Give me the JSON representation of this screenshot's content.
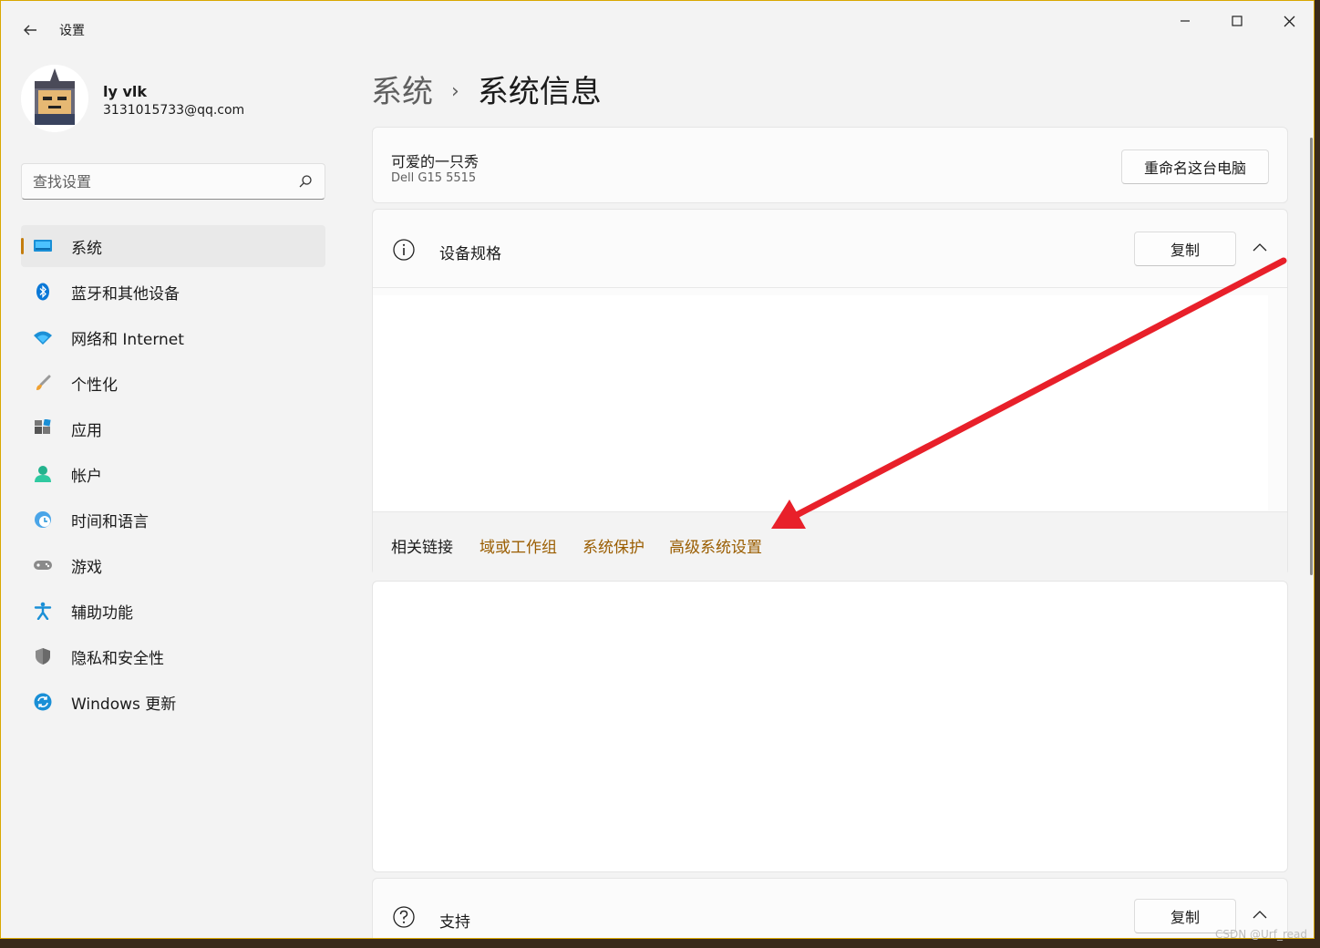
{
  "window": {
    "title": "设置",
    "back_icon": "back-arrow-icon",
    "controls": {
      "minimize": "—",
      "maximize": "☐",
      "close": "✕"
    }
  },
  "profile": {
    "name": "ly vlk",
    "email": "3131015733@qq.com"
  },
  "search": {
    "placeholder": "查找设置",
    "icon": "search-icon"
  },
  "sidebar": {
    "items": [
      {
        "label": "系统",
        "icon": "monitor-icon",
        "active": true
      },
      {
        "label": "蓝牙和其他设备",
        "icon": "bluetooth-icon"
      },
      {
        "label": "网络和 Internet",
        "icon": "wifi-icon"
      },
      {
        "label": "个性化",
        "icon": "brush-icon"
      },
      {
        "label": "应用",
        "icon": "apps-icon"
      },
      {
        "label": "帐户",
        "icon": "account-icon"
      },
      {
        "label": "时间和语言",
        "icon": "globe-clock-icon"
      },
      {
        "label": "游戏",
        "icon": "gamepad-icon"
      },
      {
        "label": "辅助功能",
        "icon": "accessibility-icon"
      },
      {
        "label": "隐私和安全性",
        "icon": "shield-icon"
      },
      {
        "label": "Windows 更新",
        "icon": "update-icon"
      }
    ]
  },
  "main": {
    "breadcrumb": {
      "parent": "系统",
      "separator": "›",
      "current": "系统信息"
    },
    "pc": {
      "name": "可爱的一只秀",
      "model": "Dell G15 5515",
      "rename_label": "重命名这台电脑"
    },
    "spec": {
      "title": "设备规格",
      "copy_label": "复制",
      "related_label": "相关链接",
      "links": [
        "域或工作组",
        "系统保护",
        "高级系统设置"
      ]
    },
    "support": {
      "title": "支持",
      "copy_label": "复制"
    }
  },
  "colors": {
    "accent": "#c47d0e",
    "link": "#9a5d00",
    "annotation_arrow": "#e8202a"
  },
  "watermark": "CSDN @Urf_read"
}
